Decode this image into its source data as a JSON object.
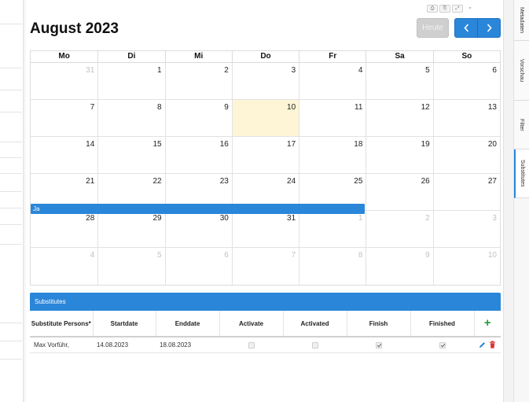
{
  "header": {
    "month_title": "August 2023",
    "today_label": "Heute"
  },
  "mini_toolbar": [
    "⎙",
    "⎘",
    "⤢",
    "▾"
  ],
  "calendar": {
    "weekdays": [
      "Mo",
      "Di",
      "Mi",
      "Do",
      "Fr",
      "Sa",
      "So"
    ],
    "weeks": [
      [
        {
          "d": "31",
          "o": true
        },
        {
          "d": "1"
        },
        {
          "d": "2"
        },
        {
          "d": "3"
        },
        {
          "d": "4"
        },
        {
          "d": "5"
        },
        {
          "d": "6"
        }
      ],
      [
        {
          "d": "7"
        },
        {
          "d": "8"
        },
        {
          "d": "9"
        },
        {
          "d": "10",
          "t": true
        },
        {
          "d": "11"
        },
        {
          "d": "12"
        },
        {
          "d": "13"
        }
      ],
      [
        {
          "d": "14"
        },
        {
          "d": "15"
        },
        {
          "d": "16"
        },
        {
          "d": "17"
        },
        {
          "d": "18"
        },
        {
          "d": "19"
        },
        {
          "d": "20"
        }
      ],
      [
        {
          "d": "21"
        },
        {
          "d": "22"
        },
        {
          "d": "23"
        },
        {
          "d": "24"
        },
        {
          "d": "25"
        },
        {
          "d": "26"
        },
        {
          "d": "27"
        }
      ],
      [
        {
          "d": "28"
        },
        {
          "d": "29"
        },
        {
          "d": "30"
        },
        {
          "d": "31"
        },
        {
          "d": "1",
          "o": true
        },
        {
          "d": "2",
          "o": true
        },
        {
          "d": "3",
          "o": true
        }
      ],
      [
        {
          "d": "4",
          "o": true
        },
        {
          "d": "5",
          "o": true
        },
        {
          "d": "6",
          "o": true
        },
        {
          "d": "7",
          "o": true
        },
        {
          "d": "8",
          "o": true
        },
        {
          "d": "9",
          "o": true
        },
        {
          "d": "10",
          "o": true
        }
      ]
    ],
    "event": {
      "label": "Ja",
      "color": "#2a86d9"
    }
  },
  "substitutes": {
    "title": "Substitutes",
    "columns": [
      "Substitute Persons*",
      "Startdate",
      "Enddate",
      "Activate",
      "Activated",
      "Finish",
      "Finished"
    ],
    "rows": [
      {
        "person": "Max Vorführ,",
        "start": "14.08.2023",
        "end": "18.08.2023",
        "activate": false,
        "activated": false,
        "finish": true,
        "finished": true
      }
    ]
  },
  "right_tabs": [
    "Metadaten",
    "Vorschau",
    "Filter",
    "Substitutes"
  ],
  "colors": {
    "accent": "#2a86d9",
    "today": "#fdf5d6",
    "add": "#1e9a3a",
    "delete": "#d9343a"
  }
}
